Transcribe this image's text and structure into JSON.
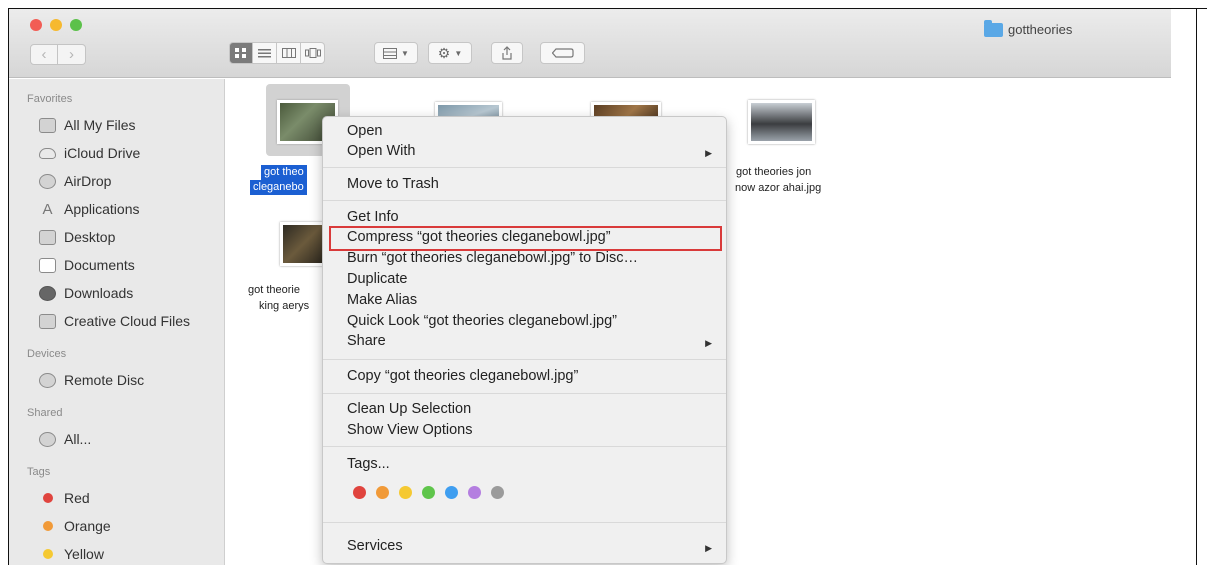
{
  "window": {
    "title": "gottheories"
  },
  "toolbar": {
    "back": "‹",
    "forward": "›"
  },
  "sidebar": {
    "favorites_header": "Favorites",
    "favorites": [
      "All My Files",
      "iCloud Drive",
      "AirDrop",
      "Applications",
      "Desktop",
      "Documents",
      "Downloads",
      "Creative Cloud Files"
    ],
    "devices_header": "Devices",
    "devices": [
      "Remote Disc"
    ],
    "shared_header": "Shared",
    "shared": [
      "All..."
    ],
    "tags_header": "Tags",
    "tags": [
      {
        "label": "Red",
        "color": "#e0443e"
      },
      {
        "label": "Orange",
        "color": "#f19a38"
      },
      {
        "label": "Yellow",
        "color": "#f5c932"
      }
    ]
  },
  "files": {
    "f1_line1": "got theo",
    "f1_line2": "cleganebo",
    "f4_line1": "got theories jon",
    "f4_line2": "now azor ahai.jpg",
    "f5_line1": "got theorie",
    "f5_line2": "king aerys"
  },
  "menu": {
    "open": "Open",
    "open_with": "Open With",
    "move_to_trash": "Move to Trash",
    "get_info": "Get Info",
    "compress": "Compress “got theories cleganebowl.jpg”",
    "burn": "Burn “got theories cleganebowl.jpg” to Disc…",
    "duplicate": "Duplicate",
    "make_alias": "Make Alias",
    "quick_look": "Quick Look “got theories cleganebowl.jpg”",
    "share": "Share",
    "copy": "Copy “got theories cleganebowl.jpg”",
    "clean_up": "Clean Up Selection",
    "show_view_options": "Show View Options",
    "tags": "Tags...",
    "tag_colors": [
      "#e0443e",
      "#f19a38",
      "#f5c932",
      "#5fc54b",
      "#3f9ef0",
      "#b47ee0",
      "#9b9b9b"
    ],
    "services": "Services"
  }
}
